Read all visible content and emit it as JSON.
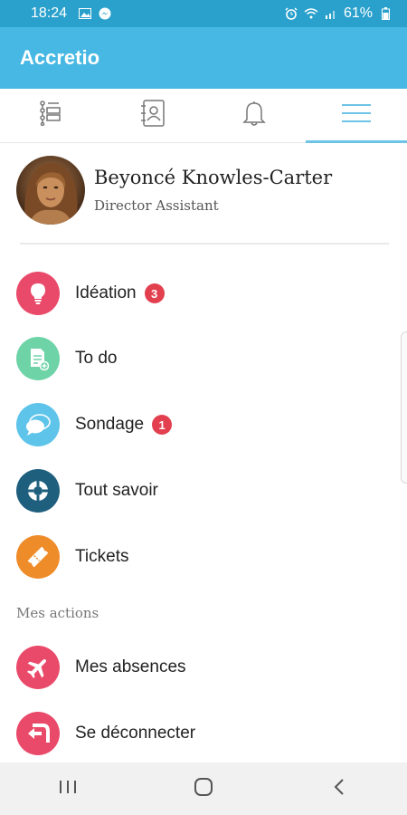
{
  "status_bar": {
    "time": "18:24",
    "battery": "61%",
    "icons": [
      "image-icon",
      "messenger-icon",
      "alarm-icon",
      "wifi-icon",
      "signal-icon",
      "battery-icon"
    ]
  },
  "app": {
    "title": "Accretio"
  },
  "tabs": [
    {
      "icon": "list-icon",
      "active": false
    },
    {
      "icon": "contacts-icon",
      "active": false
    },
    {
      "icon": "bell-icon",
      "active": false
    },
    {
      "icon": "menu-icon",
      "active": true
    }
  ],
  "profile": {
    "name": "Beyoncé Knowles-Carter",
    "role": "Director Assistant"
  },
  "menu": [
    {
      "label": "Idéation",
      "badge": "3",
      "icon": "lightbulb-icon",
      "color": "#ea4a6a"
    },
    {
      "label": "To do",
      "badge": null,
      "icon": "document-add-icon",
      "color": "#6fd3a8"
    },
    {
      "label": "Sondage",
      "badge": "1",
      "icon": "chat-bubbles-icon",
      "color": "#5ec4ea"
    },
    {
      "label": "Tout savoir",
      "badge": null,
      "icon": "lifebuoy-icon",
      "color": "#1f5f7e"
    },
    {
      "label": "Tickets",
      "badge": null,
      "icon": "ticket-icon",
      "color": "#ef8c2a"
    }
  ],
  "section": {
    "label": "Mes actions"
  },
  "actions": [
    {
      "label": "Mes absences",
      "icon": "airplane-icon",
      "color": "#ea4a6a"
    },
    {
      "label": "Se déconnecter",
      "icon": "logout-icon",
      "color": "#ea4a6a"
    }
  ],
  "nav": [
    "recents-icon",
    "home-icon",
    "back-icon"
  ],
  "colors": {
    "primary": "#47b8e3",
    "status": "#2aa1cc",
    "badge": "#e2404f"
  }
}
